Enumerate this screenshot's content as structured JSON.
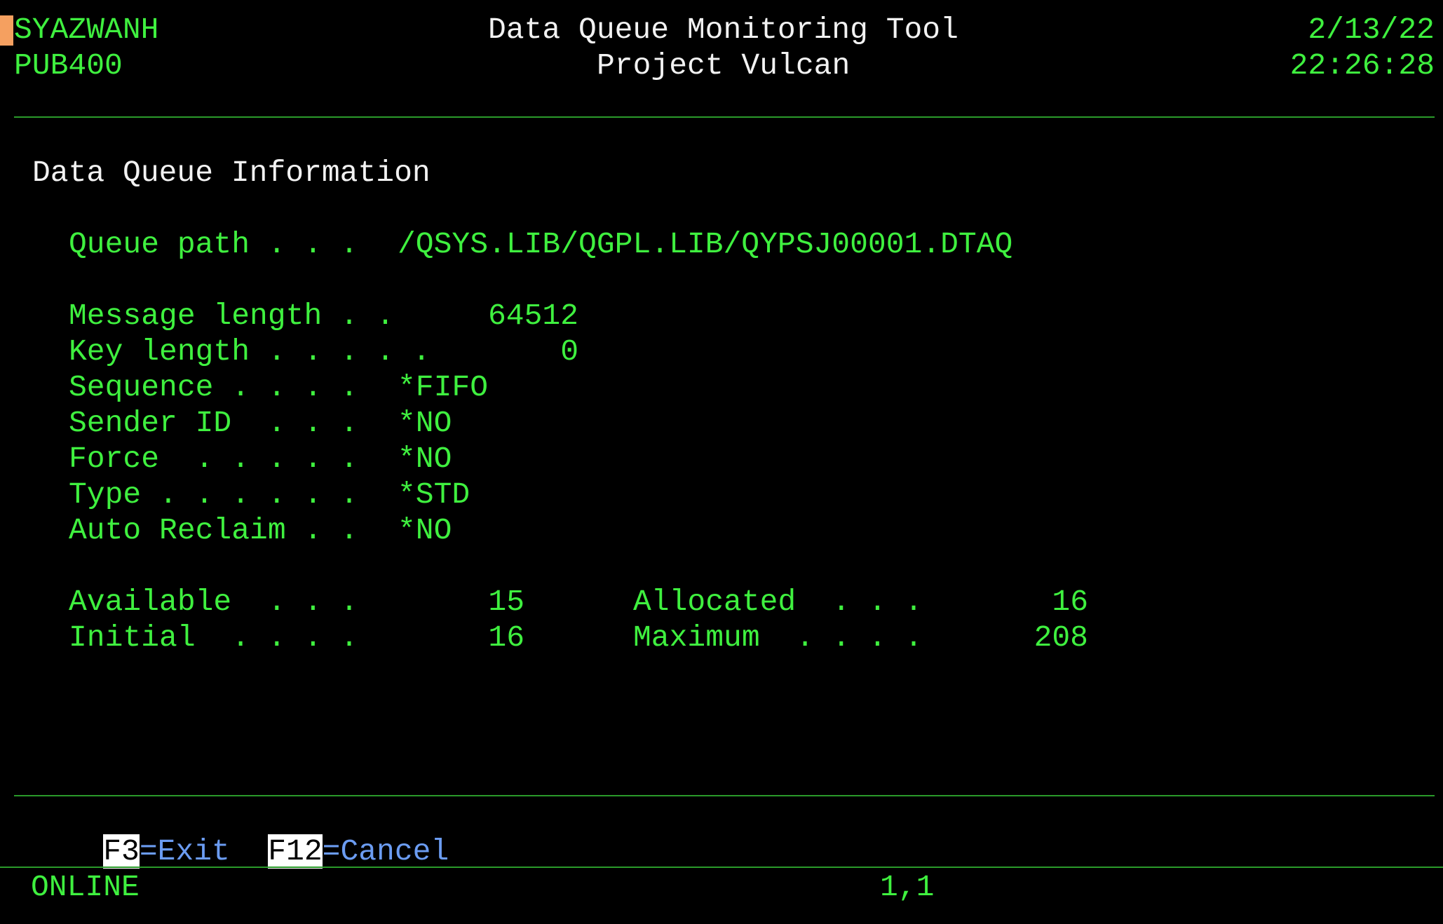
{
  "header": {
    "user": "SYAZWANH",
    "system": "PUB400",
    "title": "Data Queue Monitoring Tool",
    "subtitle": "Project Vulcan",
    "date": "2/13/22",
    "time": "22:26:28"
  },
  "section": {
    "heading": "Data Queue Information"
  },
  "fields": {
    "queue_path_label": "Queue path . . .",
    "queue_path_value": "/QSYS.LIB/QGPL.LIB/QYPSJ00001.DTAQ",
    "message_length_label": "Message length . .",
    "message_length_value": "64512",
    "key_length_label": "Key length . . . . .",
    "key_length_value": "0",
    "sequence_label": "Sequence . . . .",
    "sequence_value": "*FIFO",
    "sender_id_label": "Sender ID  . . .",
    "sender_id_value": "*NO",
    "force_label": "Force  . . . . .",
    "force_value": "*NO",
    "type_label": "Type . . . . . .",
    "type_value": "*STD",
    "auto_reclaim_label": "Auto Reclaim . .",
    "auto_reclaim_value": "*NO",
    "available_label": "Available  . . .",
    "available_value": "15",
    "initial_label": "Initial  . . . .",
    "initial_value": "16",
    "allocated_label": "Allocated  . . .",
    "allocated_value": "16",
    "maximum_label": "Maximum  . . . .",
    "maximum_value": "208"
  },
  "function_keys": [
    {
      "key": "F3",
      "action": "=Exit"
    },
    {
      "key": "F12",
      "action": "=Cancel"
    }
  ],
  "status_bar": {
    "status": "ONLINE",
    "cursor_position": "1,1"
  },
  "colors": {
    "background": "#000000",
    "field_green": "#3ff03f",
    "heading_white": "#f2f2f2",
    "function_key_blue": "#6b9cf2",
    "cursor_orange": "#f5a060"
  }
}
